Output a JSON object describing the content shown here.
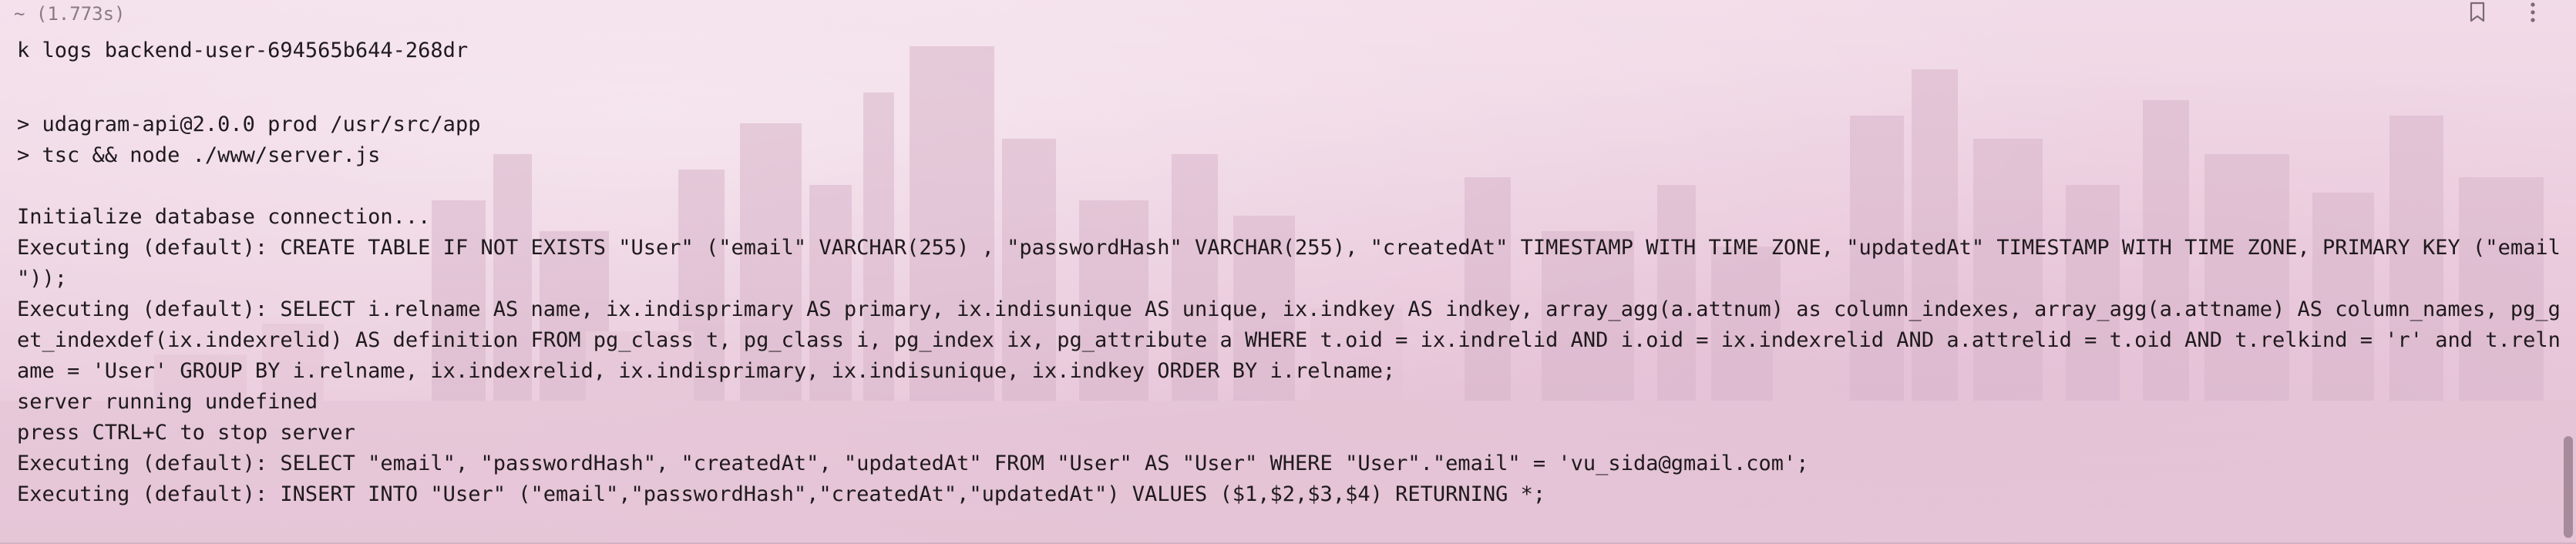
{
  "block": {
    "meta": "~ (1.773s)",
    "command": "k logs backend-user-694565b644-268dr"
  },
  "header": {
    "bookmark_icon": "bookmark-icon",
    "more_icon": "more-vertical-icon"
  },
  "output": {
    "lines": [
      "> udagram-api@2.0.0 prod /usr/src/app",
      "> tsc && node ./www/server.js",
      "",
      "Initialize database connection...",
      "Executing (default): CREATE TABLE IF NOT EXISTS \"User\" (\"email\" VARCHAR(255) , \"passwordHash\" VARCHAR(255), \"createdAt\" TIMESTAMP WITH TIME ZONE, \"updatedAt\" TIMESTAMP WITH TIME ZONE, PRIMARY KEY (\"email",
      "\"));",
      "Executing (default): SELECT i.relname AS name, ix.indisprimary AS primary, ix.indisunique AS unique, ix.indkey AS indkey, array_agg(a.attnum) as column_indexes, array_agg(a.attname) AS column_names, pg_g",
      "et_indexdef(ix.indexrelid) AS definition FROM pg_class t, pg_class i, pg_index ix, pg_attribute a WHERE t.oid = ix.indrelid AND i.oid = ix.indexrelid AND a.attrelid = t.oid AND t.relkind = 'r' and t.reln",
      "ame = 'User' GROUP BY i.relname, ix.indexrelid, ix.indisprimary, ix.indisunique, ix.indkey ORDER BY i.relname;",
      "server running undefined",
      "press CTRL+C to stop server",
      "Executing (default): SELECT \"email\", \"passwordHash\", \"createdAt\", \"updatedAt\" FROM \"User\" AS \"User\" WHERE \"User\".\"email\" = 'vu_sida@gmail.com';",
      "Executing (default): INSERT INTO \"User\" (\"email\",\"passwordHash\",\"createdAt\",\"updatedAt\") VALUES ($1,$2,$3,$4) RETURNING *;"
    ]
  },
  "colors": {
    "text": "#1f1a1d",
    "meta": "#8a7a85",
    "background": "#efd7e5"
  }
}
